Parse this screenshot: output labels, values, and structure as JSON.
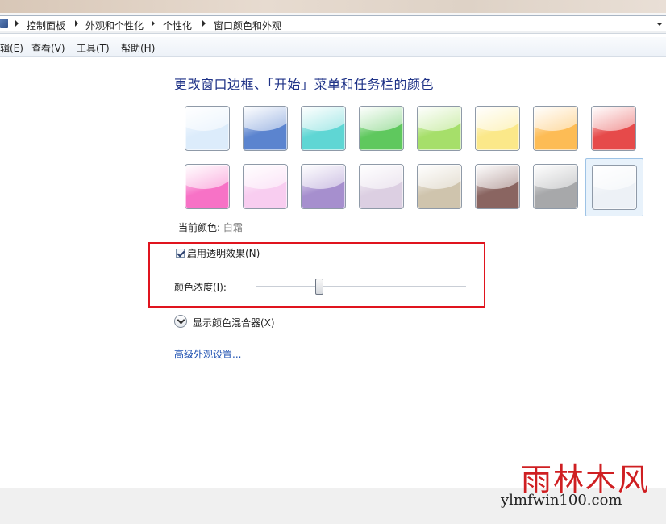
{
  "breadcrumb": {
    "items": [
      "控制面板",
      "外观和个性化",
      "个性化",
      "窗口颜色和外观"
    ]
  },
  "menubar": {
    "items": [
      "编辑(E)",
      "查看(V)",
      "工具(T)",
      "帮助(H)"
    ]
  },
  "main": {
    "heading": "更改窗口边框、「开始」菜单和任务栏的颜色",
    "swatches": [
      {
        "name": "sky",
        "color": "#dcecfb"
      },
      {
        "name": "twilight",
        "color": "#5b84cf"
      },
      {
        "name": "sea",
        "color": "#5fd6d4"
      },
      {
        "name": "leaf",
        "color": "#5fc85e"
      },
      {
        "name": "lime",
        "color": "#a6df6a"
      },
      {
        "name": "pumpkin",
        "color": "#fbe889"
      },
      {
        "name": "tangerine",
        "color": "#fdbc55"
      },
      {
        "name": "ruby",
        "color": "#e64a4a"
      },
      {
        "name": "fuchsia",
        "color": "#f772c6"
      },
      {
        "name": "blush",
        "color": "#f8cdf0"
      },
      {
        "name": "violet",
        "color": "#a68fce"
      },
      {
        "name": "lavender",
        "color": "#dccfe2"
      },
      {
        "name": "taupe",
        "color": "#cfc4ad"
      },
      {
        "name": "chocolate",
        "color": "#8a6561"
      },
      {
        "name": "slate",
        "color": "#a7a8aa"
      },
      {
        "name": "frost",
        "color": "#edf1f6"
      }
    ],
    "selected_index": 15,
    "current_color_label": "当前颜色:",
    "current_color_value": "白霜",
    "transparency_checkbox": {
      "label": "启用透明效果(N)",
      "checked": true
    },
    "intensity": {
      "label": "颜色浓度(I):",
      "value_fraction": 0.3
    },
    "mixer_toggle_label": "显示颜色混合器(X)",
    "advanced_link": "高级外观设置..."
  },
  "watermark": {
    "chinese": "雨林木风",
    "url": "ylmfwin100.com"
  },
  "colors": {
    "heading": "#1e3287",
    "link": "#1c4fb0",
    "highlight_box": "#e0141e",
    "watermark_red": "#cf1f22"
  }
}
